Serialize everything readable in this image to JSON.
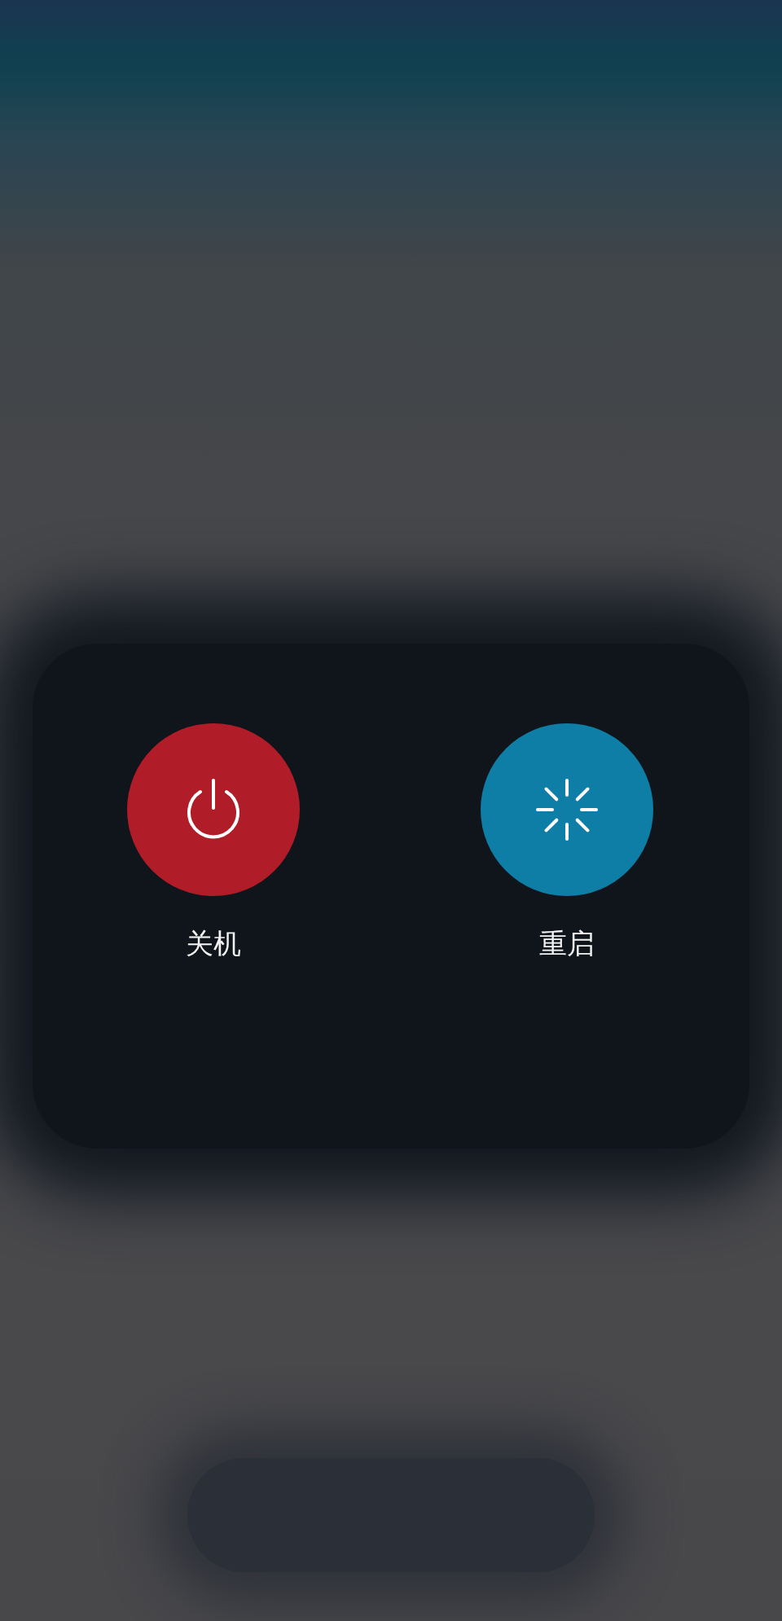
{
  "actions": [
    {
      "kind": "power",
      "label": "关机",
      "color": "#b01c28"
    },
    {
      "kind": "restart",
      "label": "重启",
      "color": "#0f7ea6"
    }
  ]
}
